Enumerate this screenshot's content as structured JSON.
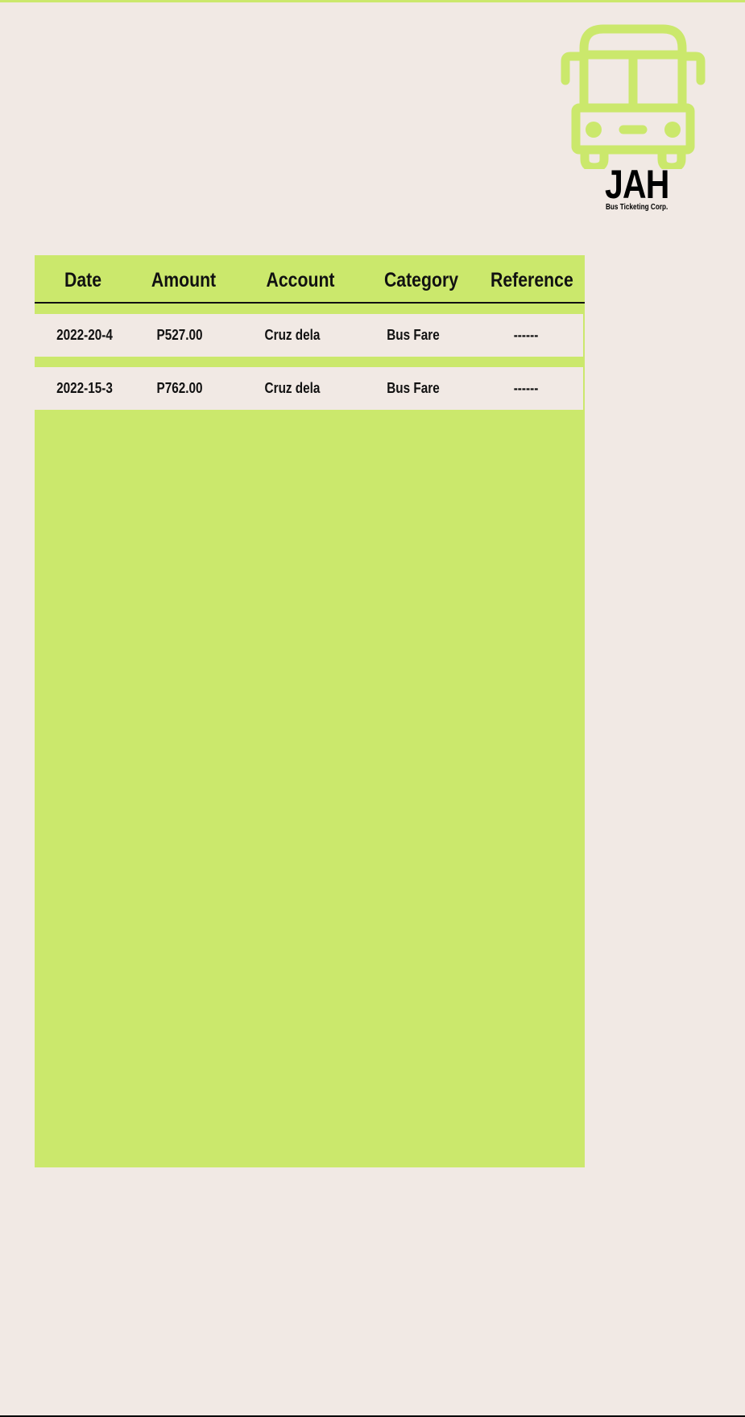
{
  "brand": {
    "name": "JAH",
    "tagline": "Bus Ticketing Corp.",
    "icon": "bus-icon",
    "accent_color": "#cbe86c"
  },
  "table": {
    "headers": {
      "date": "Date",
      "amount": "Amount",
      "account": "Account",
      "category": "Category",
      "reference": "Reference"
    },
    "rows": [
      {
        "date": "2022-20-4",
        "amount": "P527.00",
        "account": "Cruz dela",
        "category": "Bus Fare",
        "reference": "------"
      },
      {
        "date": "2022-15-3",
        "amount": "P762.00",
        "account": "Cruz dela",
        "category": "Bus Fare",
        "reference": "------"
      }
    ]
  },
  "colors": {
    "background": "#f1e9e4",
    "panel": "#cbe86c",
    "text": "#111111"
  }
}
